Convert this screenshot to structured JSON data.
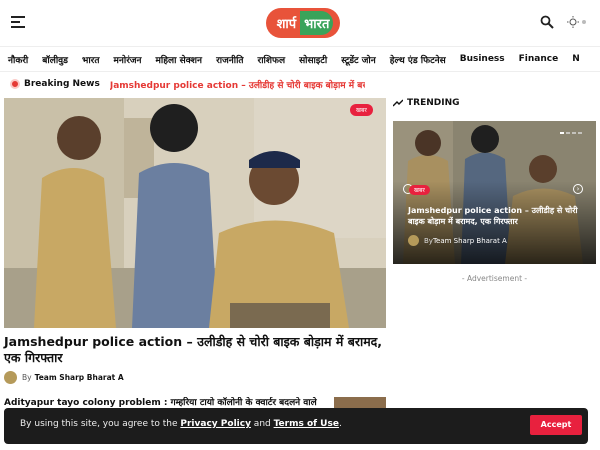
{
  "header": {
    "logo_left": "शार्प",
    "logo_right": "भारत"
  },
  "nav": {
    "items": [
      "नौकरी",
      "बॉलीवुड",
      "भारत",
      "मनोरंजन",
      "महिला सेक्शन",
      "राजनीति",
      "राशिफल",
      "सोसाइटी",
      "स्टूडेंट जोन",
      "हेल्थ एंड फिटनेस",
      "Business",
      "Finance",
      "N"
    ]
  },
  "breaking": {
    "label": "Breaking News",
    "text": "Jamshedpur police action – उलीडीह से चोरी बाइक बोड़ाम में बरा..."
  },
  "hero": {
    "badge": "खबर",
    "title": "Jamshedpur police action – उलीडीह से चोरी बाइक बोड़ाम में बरामद, एक गिरफ्तार",
    "author_prefix": "By",
    "author": "Team Sharp Bharat A"
  },
  "secondary": {
    "title": "Adityapur tayo colony problem : गम्हरिया टायो कॉलोनी के क्वार्टर बदलने वाले लोग बि..."
  },
  "trending": {
    "label": "TRENDING",
    "badge": "खबर",
    "title": "Jamshedpur police action – उलीडीह से चोरी बाइक बोड़ाम में बरामद, एक गिरफ्तार",
    "author_prefix": "By",
    "author": "Team Sharp Bharat A"
  },
  "advert": "- Advertisement -",
  "cookie": {
    "text_prefix": "By using this site, you agree to the ",
    "privacy": "Privacy Policy",
    "and": " and ",
    "terms": "Terms of Use",
    "suffix": ".",
    "accept": "Accept"
  },
  "colors": {
    "accent": "#e8213e",
    "breaking_text": "#e53935",
    "logo_orange": "#e8533a",
    "logo_green": "#3aa35a"
  }
}
